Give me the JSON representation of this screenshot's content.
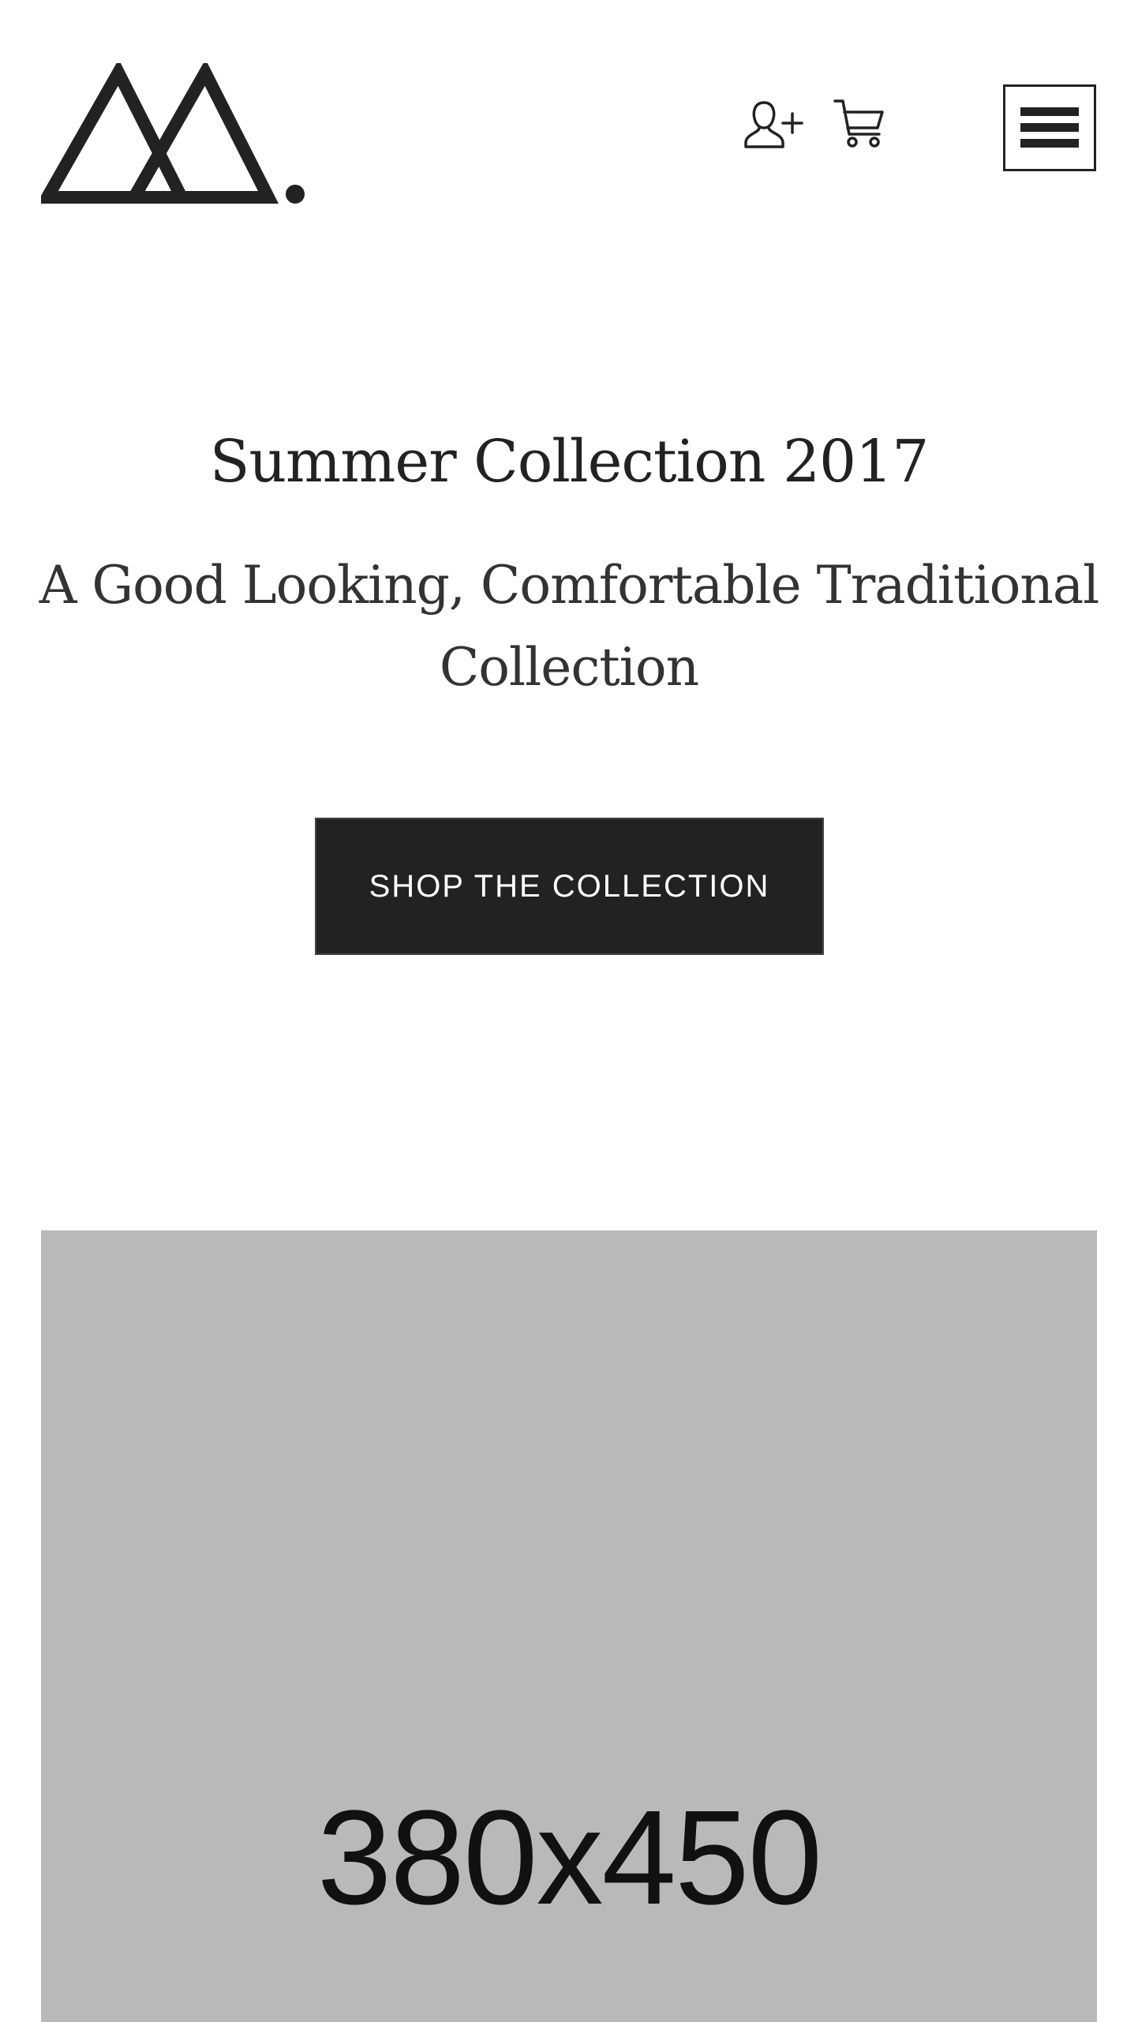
{
  "header": {
    "logo_name": "mountain-logo",
    "account_icon": "user-plus-icon",
    "cart_icon": "shopping-cart-icon",
    "menu_icon": "hamburger-menu-icon"
  },
  "hero": {
    "title": "Summer Collection 2017",
    "subtitle": "A Good Looking, Comfortable Traditional Collection",
    "cta_label": "SHOP THE COLLECTION"
  },
  "featured_image": {
    "placeholder_text": "380x450",
    "background_color": "#b9b9b9"
  },
  "colors": {
    "primary": "#222222",
    "background": "#ffffff",
    "button_text": "#ffffff"
  }
}
